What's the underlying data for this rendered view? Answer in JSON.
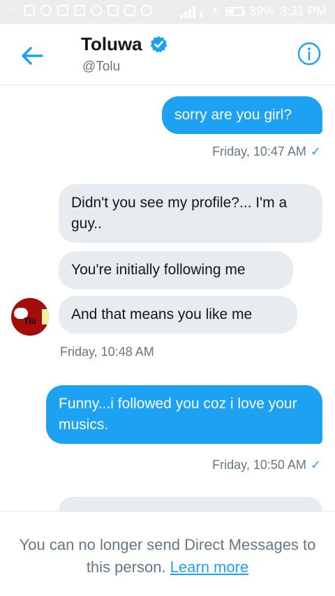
{
  "status_bar": {
    "battery": "39%",
    "time": "3:31 PM"
  },
  "header": {
    "name": "Toluwa",
    "handle": "@Tolu"
  },
  "messages": [
    {
      "direction": "out",
      "text": "sorry are you girl?"
    },
    {
      "direction": "in",
      "text": "Didn't you see my profile?... I'm a guy.."
    },
    {
      "direction": "in",
      "text": "You're initially following me"
    },
    {
      "direction": "in",
      "text": "And that means you like me"
    },
    {
      "direction": "out",
      "text": "Funny...i followed you coz i love your musics."
    }
  ],
  "timestamps": {
    "t1": "Friday, 10:47 AM",
    "t2": "Friday, 10:48 AM",
    "t3": "Friday, 10:50 AM"
  },
  "avatar_text": "Tlu",
  "footer": {
    "text": "You can no longer send Direct Messages to this person.",
    "link": "Learn more"
  },
  "colors": {
    "accent": "#1da1f2",
    "incoming_bubble": "#e6ecf0",
    "muted_text": "#657786"
  }
}
